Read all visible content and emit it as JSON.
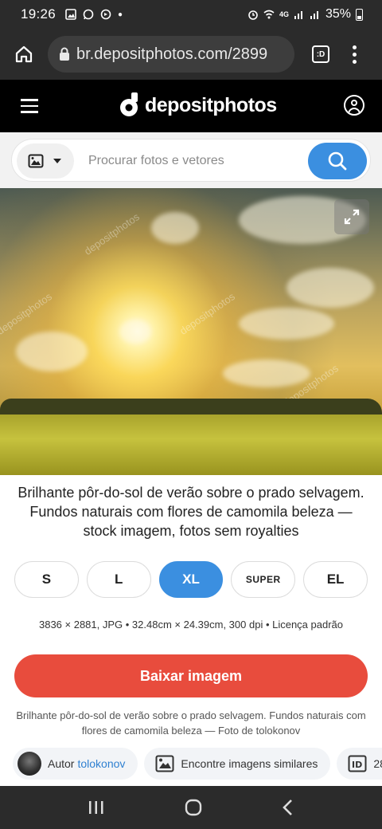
{
  "status_bar": {
    "time": "19:26",
    "network": "4G",
    "battery": "35%"
  },
  "browser": {
    "url": "br.depositphotos.com/2899",
    "tab_label": ":D"
  },
  "header": {
    "logo_text": "depositphotos"
  },
  "search": {
    "placeholder": "Procurar fotos e vetores"
  },
  "image": {
    "watermark": "depositphotos"
  },
  "title": "Brilhante pôr-do-sol de verão sobre o prado selvagem. Fundos naturais com flores de camomila beleza — stock imagem, fotos sem royalties",
  "sizes": [
    {
      "label": "S",
      "active": false
    },
    {
      "label": "L",
      "active": false
    },
    {
      "label": "XL",
      "active": true
    },
    {
      "label": "SUPER",
      "active": false
    },
    {
      "label": "EL",
      "active": false
    }
  ],
  "specs": "3836 × 2881, JPG • 32.48cm × 24.39cm, 300 dpi • Licença padrão",
  "download_label": "Baixar imagem",
  "caption": "Brilhante pôr-do-sol de verão sobre o prado selvagem. Fundos naturais com flores de camomila beleza — Foto de tolokonov",
  "chips": {
    "author_prefix": "Autor",
    "author_name": "tolokonov",
    "similar_label": "Encontre imagens similares",
    "id_value": "28"
  },
  "colors": {
    "accent": "#3b8fe0",
    "download": "#e84c3d",
    "header": "#000000"
  }
}
